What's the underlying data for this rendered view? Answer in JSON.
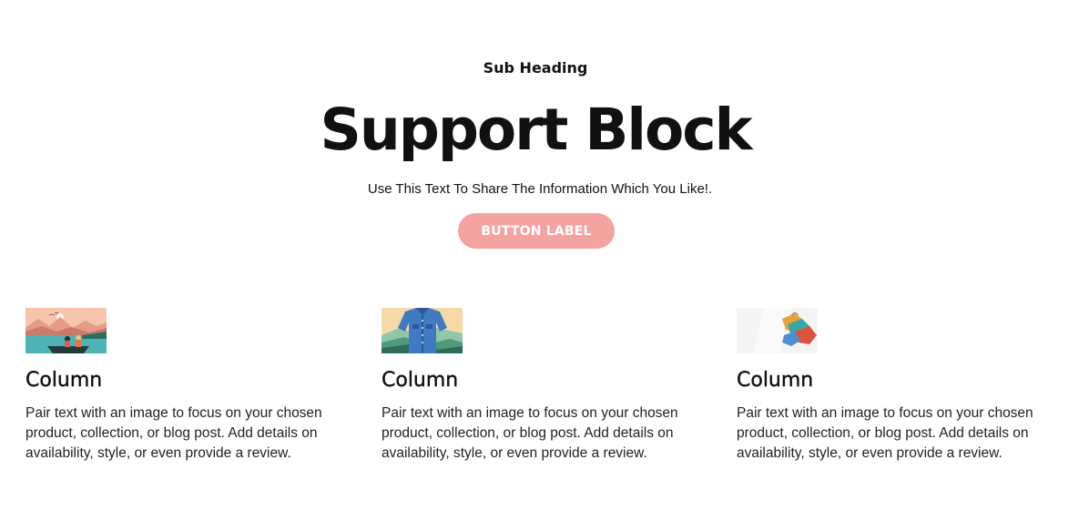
{
  "hero": {
    "sub_heading": "Sub Heading",
    "title": "Support Block",
    "description": "Use This Text To Share The Information Which You Like!.",
    "button_label": "BUTTON LABEL",
    "button_color": "#f5a3a1"
  },
  "columns": [
    {
      "image": "lake-landscape-illustration",
      "title": "Column",
      "text": "Pair text with an image to focus on your chosen product, collection, or blog post. Add details on availability, style, or even provide a review."
    },
    {
      "image": "shirt-landscape-illustration",
      "title": "Column",
      "text": "Pair text with an image to focus on your chosen product, collection, or blog post. Add details on availability, style, or even provide a review."
    },
    {
      "image": "clothes-stack-illustration",
      "title": "Column",
      "text": "Pair text with an image to focus on your chosen product, collection, or blog post. Add details on availability, style, or even provide a review."
    }
  ]
}
